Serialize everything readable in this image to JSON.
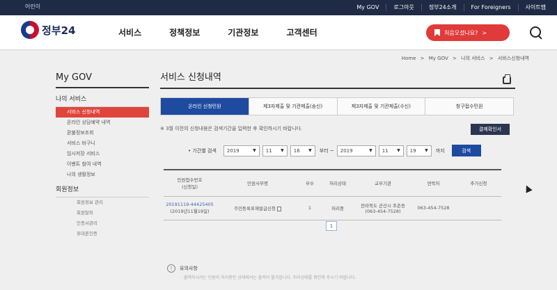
{
  "topbar": {
    "left_label": "어린이",
    "links": [
      "My GOV",
      "로그아웃",
      "정부24소개",
      "For Foreigners",
      "사이트맵"
    ]
  },
  "header": {
    "logo_text": "정부24",
    "gnb": [
      "서비스",
      "정책정보",
      "기관정보",
      "고객센터"
    ],
    "first_visit": "처음오셨나요?",
    "first_visit_arrow": ">"
  },
  "breadcrumb": [
    "Home",
    ">",
    "My GOV",
    ">",
    "나의 서비스",
    ">",
    "서비스신청내역"
  ],
  "lnb": {
    "title": "My GOV",
    "section1": "나의 서비스",
    "items": [
      {
        "label": "서비스 신청내역",
        "active": true
      },
      {
        "label": "온라인 상담예약 내역",
        "active": false
      },
      {
        "label": "환불정보조회",
        "active": false
      },
      {
        "label": "서비스 바구니",
        "active": false
      },
      {
        "label": "임시저장 서비스",
        "active": false
      },
      {
        "label": "이벤트 참여 내역",
        "active": false
      },
      {
        "label": "나의 생활정보",
        "active": false
      }
    ],
    "section2": "회원정보",
    "sub_items": [
      "회원정보 관리",
      "회원탈퇴",
      "인증서관리",
      "휴대폰인증"
    ]
  },
  "main": {
    "title": "서비스 신청내역",
    "tabs": [
      {
        "label": "온라인 신청민원",
        "active": true
      },
      {
        "label": "제3자제출 및 기관제출(송신)",
        "active": false
      },
      {
        "label": "제3자제출 및 기관제출(수신)",
        "active": false
      },
      {
        "label": "창구접수민원",
        "active": false
      }
    ],
    "notice": "※ 3월 이전의 신청내용은 검색기간을 입력한 후 확인하시기 바랍니다.",
    "pay_button": "결제확인서",
    "filter": {
      "label": "• 기간별 검색",
      "from_year": "2019",
      "from_month": "11",
      "from_day": "16",
      "from_suffix": "부터 ~",
      "to_year": "2019",
      "to_month": "11",
      "to_day": "19",
      "to_suffix": "까지",
      "search": "검색"
    },
    "table": {
      "headers": [
        "민원접수번호\n(신청일)",
        "민원사무명",
        "부수",
        "처리상태",
        "교부기관",
        "연락처",
        "추가신청"
      ],
      "rows": [
        {
          "receipt_no": "20191119-44425405",
          "date": "(2019년11월19일)",
          "name": "주민등록표재발급신청",
          "copies": "1",
          "status": "처리중",
          "agency": "전라북도 군산시 조촌동",
          "agency_phone": "(063-454-7528)",
          "contact": "063-454-7528",
          "extra": ""
        }
      ]
    },
    "pager": "1",
    "guide_title": "유의사항",
    "guide_text": "· 출력하시려는 민원의 처리중인 상태에서는 출력이 불가합니다. 처리상태를 확인해 주시기 바랍니다."
  }
}
